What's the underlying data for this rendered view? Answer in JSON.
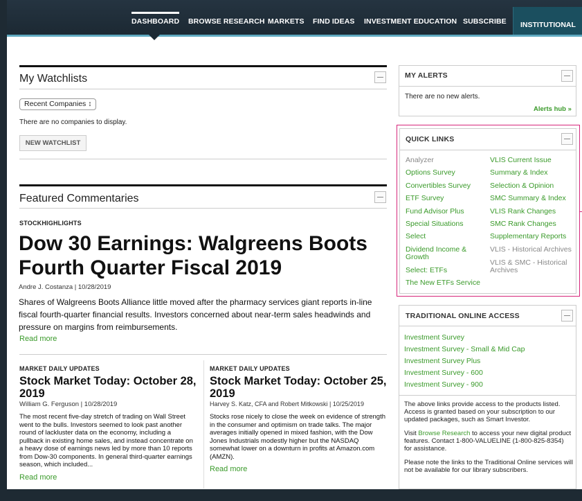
{
  "nav": {
    "items": [
      "DASHBOARD",
      "BROWSE RESEARCH",
      "MARKETS",
      "FIND IDEAS",
      "INVESTMENT EDUCATION",
      "SUBSCRIBE"
    ],
    "institutional": "INSTITUTIONAL"
  },
  "watchlists": {
    "title": "My Watchlists",
    "select_value": "Recent Companies ↕",
    "empty_text": "There are no companies to display.",
    "new_button": "NEW WATCHLIST"
  },
  "featured": {
    "title": "Featured Commentaries",
    "main": {
      "kicker": "STOCKHIGHLIGHTS",
      "headline": "Dow 30 Earnings: Walgreens Boots Fourth Quarter Fiscal 2019",
      "byline": "Andre J. Costanza  |  10/28/2019",
      "lede": "Shares of Walgreens Boots Alliance little moved after the pharmacy services giant reports in-line fiscal fourth-quarter financial results. Investors concerned about near-term sales headwinds and pressure on margins from reimbursements.",
      "read_more": "Read more"
    },
    "left": {
      "kicker": "MARKET DAILY UPDATES",
      "headline": "Stock Market Today: October 28, 2019",
      "byline": "William G. Ferguson  |  10/28/2019",
      "body": "The most recent five-day stretch of trading on Wall Street went to the bulls. Investors seemed to look past another round of lackluster data on the economy, including a pullback in existing home sales, and instead concentrate on a heavy dose of earnings news led by more than 10 reports from Dow-30 components. In general third-quarter earnings season, which included...",
      "read_more": "Read more"
    },
    "right": {
      "kicker": "MARKET DAILY UPDATES",
      "headline": "Stock Market Today: October 25, 2019",
      "byline": "Harvey S. Katz, CFA and Robert Mitkowski  |  10/25/2019",
      "body": "Stocks rose nicely to close the week on evidence of strength in the consumer and optimism on trade talks. The major averages initially opened in mixed fashion, with the Dow Jones Industrials modestly higher but the NASDAQ somewhat lower on a downturn in profits at Amazon.com (AMZN).",
      "read_more": "Read more"
    }
  },
  "alerts": {
    "title": "MY ALERTS",
    "text": "There are no new alerts.",
    "hub_link": "Alerts hub »"
  },
  "quick_links": {
    "title": "QUICK LINKS",
    "left": [
      "Analyzer",
      "Options Survey",
      "Convertibles Survey",
      "ETF Survey",
      "Fund Advisor Plus",
      "Special Situations",
      "Select",
      "Dividend Income & Growth",
      "Select: ETFs",
      "The New ETFs Service"
    ],
    "right": [
      "VLIS Current Issue",
      "Summary & Index",
      "Selection & Opinion",
      "SMC Summary & Index",
      "VLIS Rank Changes",
      "SMC Rank Changes",
      "Supplementary Reports",
      "VLIS - Historical Archives",
      "VLIS & SMC - Historical Archives"
    ]
  },
  "traditional": {
    "title": "TRADITIONAL ONLINE ACCESS",
    "links": [
      "Investment Survey",
      "Investment Survey - Small & Mid Cap",
      "Investment Survey Plus",
      "Investment Survey - 600",
      "Investment Survey - 900"
    ],
    "para1": "The above links provide access to the products listed. Access is granted based on your subscription to our updated packages, such as Smart Investor.",
    "para2_prefix": "Visit ",
    "para2_link": "Browse Research",
    "para2_suffix": " to access your new digital product features. Contact 1-800-VALUELINE (1-800-825-8354) for assistance.",
    "para3": "Please note the links to the Traditional Online services will not be available for our library subscribers."
  }
}
